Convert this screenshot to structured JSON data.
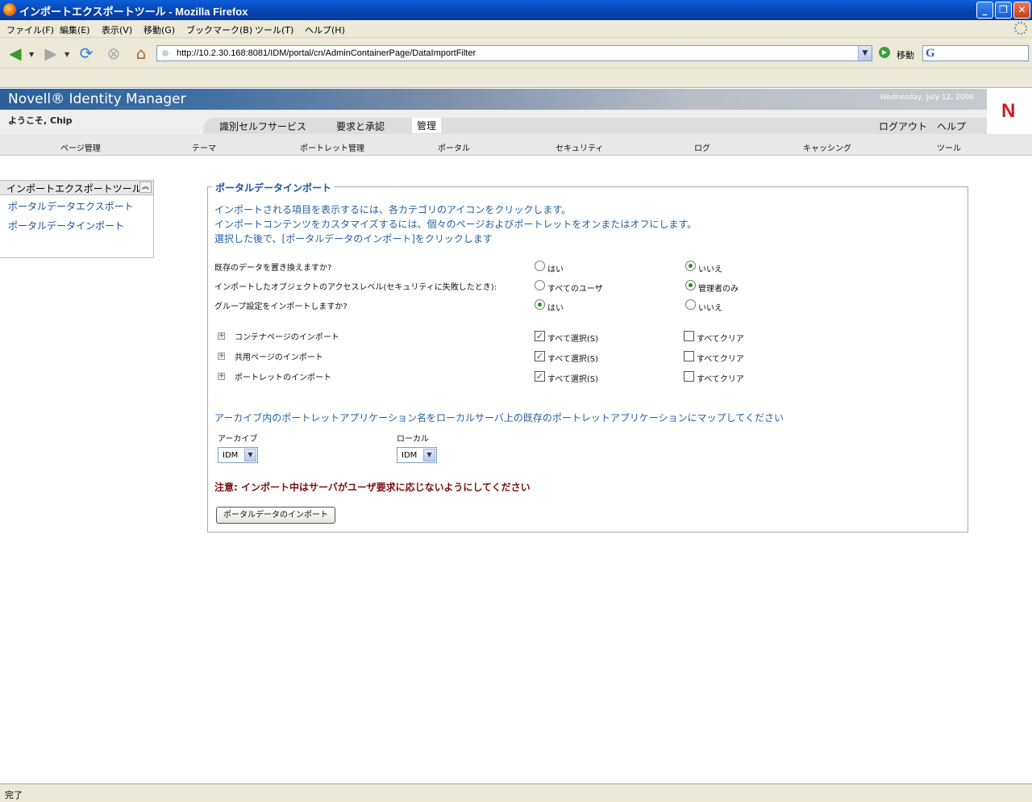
{
  "window": {
    "title": "インポートエクスポートツール - Mozilla Firefox",
    "minimize": "_",
    "restore": "❐",
    "close": "✕"
  },
  "menu": [
    "ファイル(F)",
    "編集(E)",
    "表示(V)",
    "移動(G)",
    "ブックマーク(B)",
    "ツール(T)",
    "ヘルプ(H)"
  ],
  "navbar": {
    "url": "http://10.2.30.168:8081/IDM/portal/cn/AdminContainerPage/DataImportFilter",
    "go_label": "移動",
    "search_logo": "G"
  },
  "banner": {
    "brand": "Novell® Identity Manager",
    "date": "Wednesday, July 12, 2006",
    "logo_letter": "N"
  },
  "header": {
    "welcome": "ようこそ, Chip",
    "tabs": [
      "識別セルフサービス",
      "要求と承認",
      "管理"
    ],
    "active_tab": "管理",
    "logout": "ログアウト",
    "help": "ヘルプ"
  },
  "subnav": [
    "ページ管理",
    "テーマ",
    "ポートレット管理",
    "ポータル",
    "セキュリティ",
    "ログ",
    "キャッシング",
    "ツール"
  ],
  "sidebar": {
    "title": "インポートエクスポートツール",
    "collapse_icon": "︽",
    "links": [
      "ポータルデータエクスポート",
      "ポータルデータインポート"
    ]
  },
  "panel": {
    "legend": "ポータルデータインポート",
    "instructions": [
      "インポートされる項目を表示するには、各カテゴリのアイコンをクリックします。",
      "インポートコンテンツをカスタマイズするには、個々のページおよびポートレットをオンまたはオフにします。",
      "選択した後で、[ポータルデータのインポート]をクリックします"
    ],
    "questions": [
      {
        "label": "既存のデータを置き換えますか?",
        "opt1": "はい",
        "opt2": "いいえ",
        "selected": 2
      },
      {
        "label": "インポートしたオブジェクトのアクセスレベル(セキュリティに失敗したとき):",
        "opt1": "すべてのユーザ",
        "opt2": "管理者のみ",
        "selected": 2
      },
      {
        "label": "グループ設定をインポートしますか?",
        "opt1": "はい",
        "opt2": "いいえ",
        "selected": 1
      }
    ],
    "sections": [
      {
        "label": "コンテナページのインポート",
        "select_all": "すべて選択(S)",
        "clear_all": "すべてクリア",
        "checked": true
      },
      {
        "label": "共用ページのインポート",
        "select_all": "すべて選択(S)",
        "clear_all": "すべてクリア",
        "checked": true
      },
      {
        "label": "ポートレットのインポート",
        "select_all": "すべて選択(S)",
        "clear_all": "すべてクリア",
        "checked": true
      }
    ],
    "mapping_instruction": "アーカイブ内のポートレットアプリケーション名をローカルサーバ上の既存のポートレットアプリケーションにマップしてください",
    "archive_label": "アーカイブ",
    "local_label": "ローカル",
    "archive_value": "IDM",
    "local_value": "IDM",
    "warning": "注意: インポート中はサーバがユーザ要求に応じないようにしてください",
    "import_button": "ポータルデータのインポート"
  },
  "status": "完了"
}
